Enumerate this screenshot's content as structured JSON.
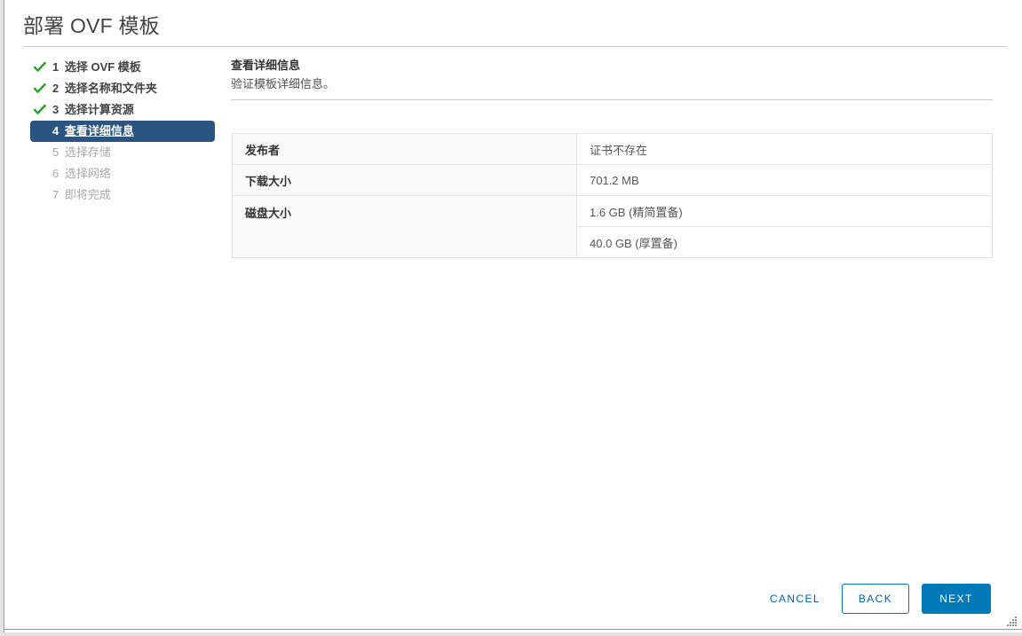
{
  "window": {
    "title": "部署 OVF 模板"
  },
  "steps": {
    "items": [
      {
        "num": "1",
        "label": "选择 OVF 模板",
        "state": "done",
        "icon": "check-icon"
      },
      {
        "num": "2",
        "label": "选择名称和文件夹",
        "state": "done",
        "icon": "check-icon"
      },
      {
        "num": "3",
        "label": "选择计算资源",
        "state": "done",
        "icon": "check-icon"
      },
      {
        "num": "4",
        "label": "查看详细信息",
        "state": "current",
        "icon": ""
      },
      {
        "num": "5",
        "label": "选择存储",
        "state": "pending",
        "icon": ""
      },
      {
        "num": "6",
        "label": "选择网络",
        "state": "pending",
        "icon": ""
      },
      {
        "num": "7",
        "label": "即将完成",
        "state": "pending",
        "icon": ""
      }
    ]
  },
  "content": {
    "heading": "查看详细信息",
    "subheading": "验证模板详细信息。"
  },
  "details": {
    "rows": [
      {
        "key": "发布者",
        "value": "证书不存在"
      },
      {
        "key": "下载大小",
        "value": "701.2 MB"
      },
      {
        "key": "磁盘大小",
        "value": "1.6 GB (精简置备)"
      },
      {
        "key": "",
        "value": "40.0 GB (厚置备)"
      }
    ]
  },
  "footer": {
    "cancel_label": "CANCEL",
    "back_label": "BACK",
    "next_label": "NEXT"
  },
  "colors": {
    "current_step_bg": "#2b5580",
    "primary_button": "#0079b8",
    "link_text": "#0065ab",
    "check_green": "#2e9e2e",
    "table_border": "#e3e3e3",
    "key_cell_bg": "#fafafa"
  }
}
